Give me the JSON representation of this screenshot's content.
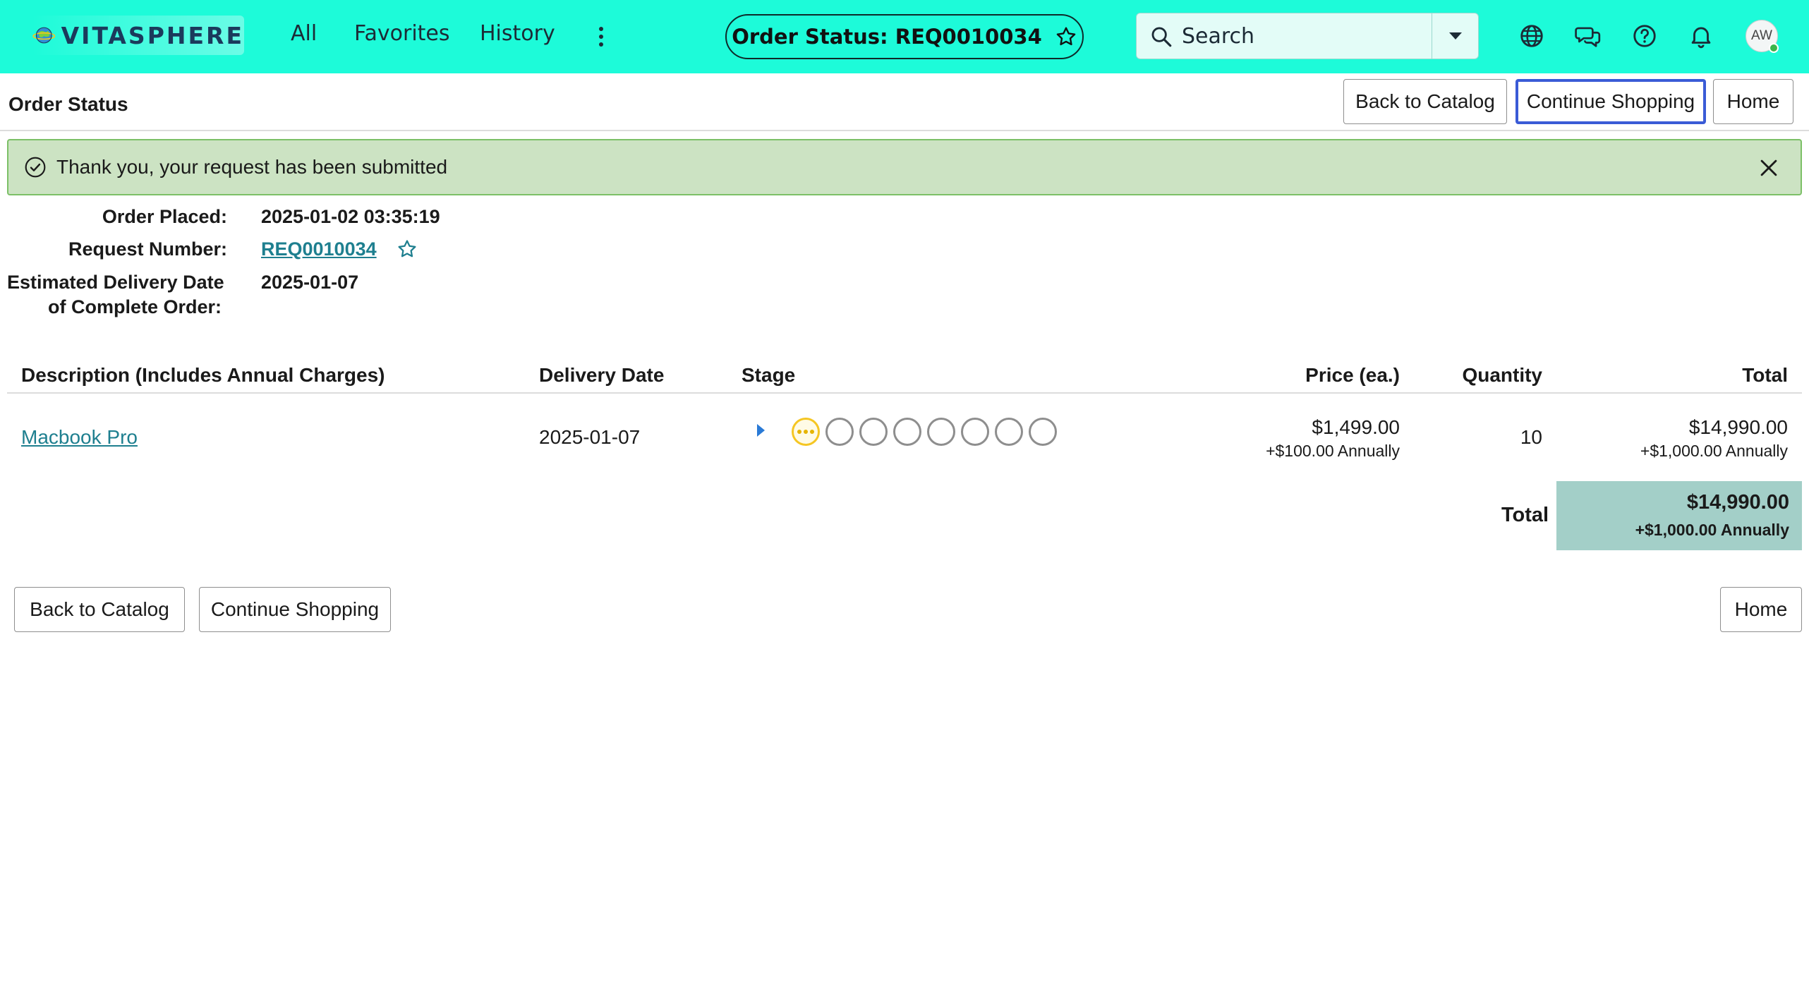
{
  "brand": {
    "name": "VITASPHERE"
  },
  "nav": {
    "links": [
      "All",
      "Favorites",
      "History"
    ],
    "status_pill": "Order Status: REQ0010034",
    "search_placeholder": "Search",
    "avatar_initials": "AW"
  },
  "colors": {
    "topbar": "#1dfbd9",
    "alert_bg": "#cce3c3",
    "link": "#1e7f8f",
    "total_bg": "#a3cfc8",
    "focus": "#3a5bd6"
  },
  "header": {
    "title": "Order Status",
    "back_label": "Back to Catalog",
    "continue_label": "Continue Shopping",
    "home_label": "Home"
  },
  "alert": {
    "message": "Thank you, your request has been submitted"
  },
  "details": {
    "order_placed_label": "Order Placed:",
    "order_placed_value": "2025-01-02 03:35:19",
    "request_number_label": "Request Number:",
    "request_number_value": "REQ0010034",
    "estimated_label_line1": "Estimated Delivery Date",
    "estimated_label_line2": "of Complete Order:",
    "estimated_value": "2025-01-07"
  },
  "table": {
    "columns": {
      "description": "Description (Includes Annual Charges)",
      "delivery": "Delivery Date",
      "stage": "Stage",
      "price": "Price (ea.)",
      "quantity": "Quantity",
      "total": "Total"
    },
    "row": {
      "item": "Macbook Pro",
      "delivery_date": "2025-01-07",
      "stage_count": 8,
      "current_stage": 1,
      "price": "$1,499.00",
      "price_annual": "+$100.00 Annually",
      "quantity": "10",
      "total": "$14,990.00",
      "total_annual": "+$1,000.00 Annually"
    },
    "grand_total_label": "Total",
    "grand_total": "$14,990.00",
    "grand_total_annual": "+$1,000.00 Annually"
  },
  "footer": {
    "back_label": "Back to Catalog",
    "continue_label": "Continue Shopping",
    "home_label": "Home"
  }
}
